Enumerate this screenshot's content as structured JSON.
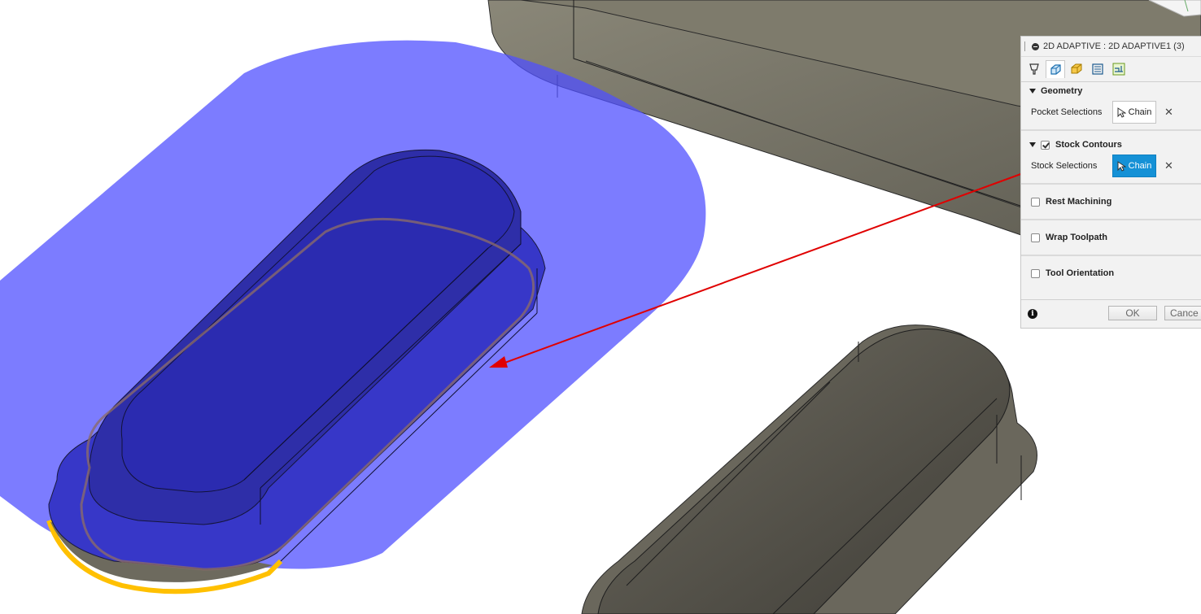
{
  "dialog": {
    "title": "2D ADAPTIVE : 2D ADAPTIVE1 (3)",
    "tabs": [
      {
        "icon": "tool-icon",
        "active": false
      },
      {
        "icon": "geometry-icon",
        "active": true
      },
      {
        "icon": "heights-icon",
        "active": false
      },
      {
        "icon": "passes-icon",
        "active": false
      },
      {
        "icon": "linking-icon",
        "active": false
      }
    ],
    "geometry": {
      "section_label": "Geometry",
      "pocket_label": "Pocket Selections",
      "pocket_button": "Chain"
    },
    "stock_contours": {
      "section_label": "Stock Contours",
      "checked": true,
      "stock_label": "Stock Selections",
      "stock_button": "Chain"
    },
    "rest_machining": {
      "label": "Rest Machining",
      "checked": false
    },
    "wrap_toolpath": {
      "label": "Wrap Toolpath",
      "checked": false
    },
    "tool_orientation": {
      "label": "Tool Orientation",
      "checked": false
    },
    "ok_label": "OK",
    "cancel_label": "Cance"
  },
  "colors": {
    "stock_highlight": "#4b4bff",
    "part_body": "#5a574e",
    "selected_edge": "#ffc000",
    "annotation_arrow": "#e00000",
    "active_button": "#1591d6"
  }
}
